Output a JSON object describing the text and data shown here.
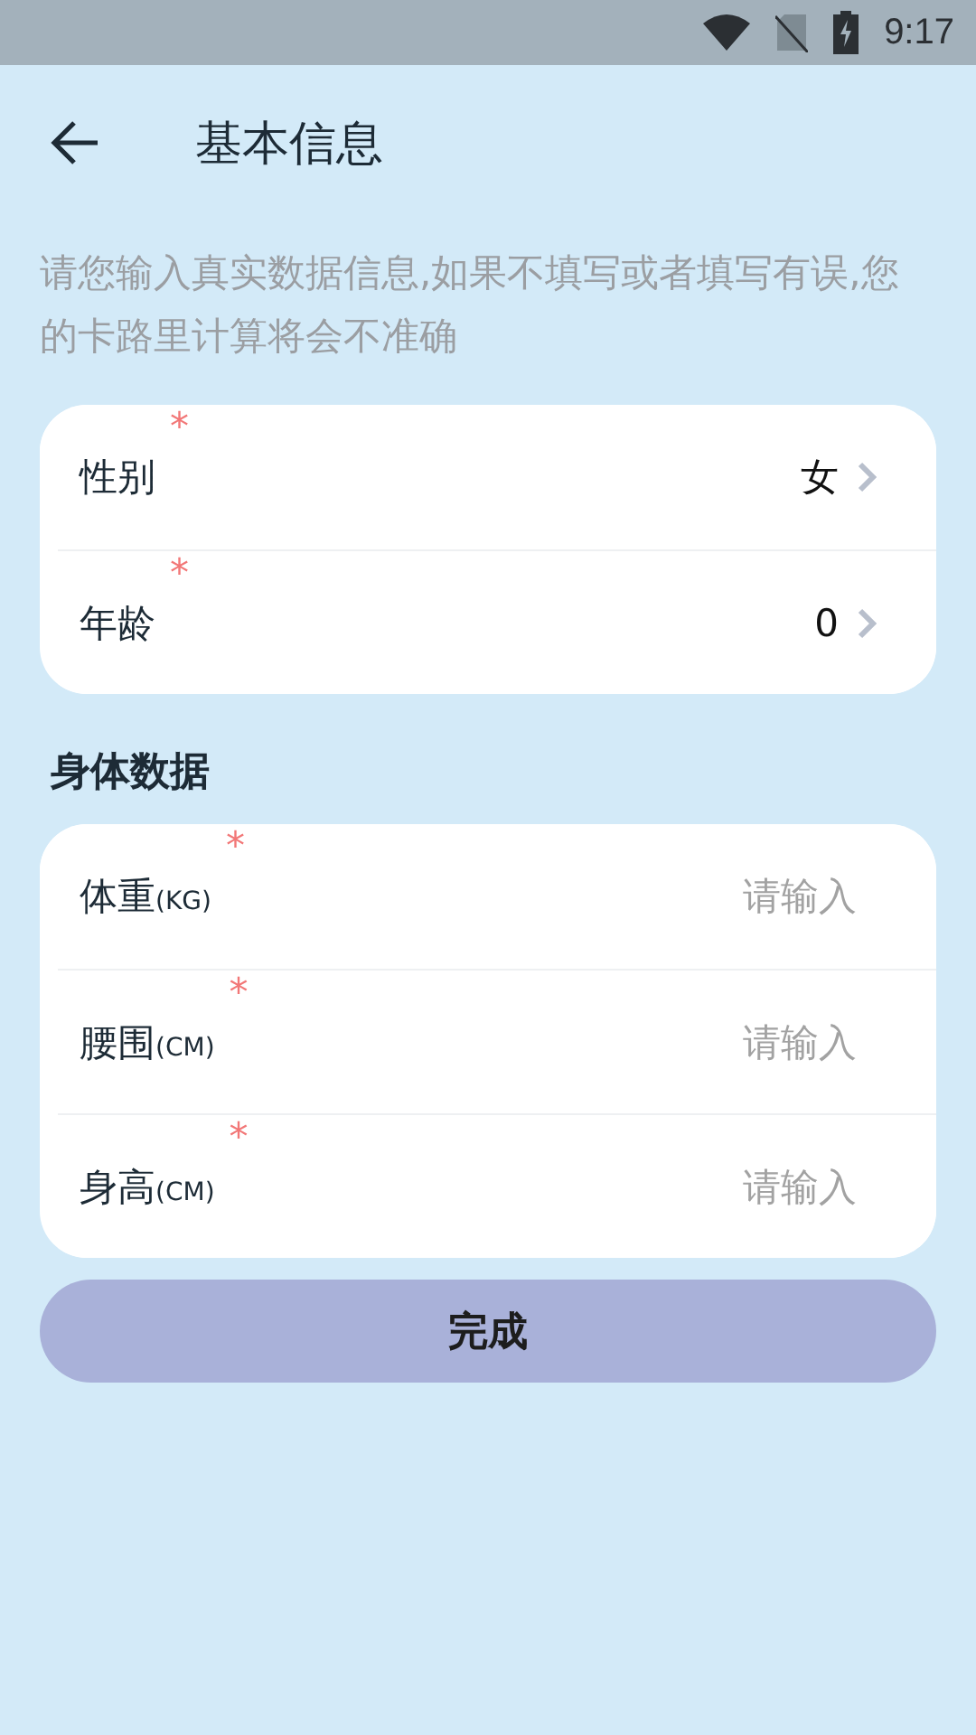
{
  "status_bar": {
    "time": "9:17"
  },
  "header": {
    "title": "基本信息"
  },
  "notice": "请您输入真实数据信息,如果不填写或者填写有误,您的卡路里计算将会不准确",
  "basic_rows": [
    {
      "label": "性别",
      "required_mark": "*",
      "value": "女"
    },
    {
      "label": "年龄",
      "required_mark": "*",
      "value": "0"
    }
  ],
  "section_title": "身体数据",
  "body_rows": [
    {
      "label": "体重",
      "unit": "(KG)",
      "required_mark": "*",
      "placeholder": "请输入"
    },
    {
      "label": "腰围",
      "unit": "(CM)",
      "required_mark": "*",
      "placeholder": "请输入"
    },
    {
      "label": "身高",
      "unit": "(CM)",
      "required_mark": "*",
      "placeholder": "请输入"
    }
  ],
  "submit_button": "完成"
}
